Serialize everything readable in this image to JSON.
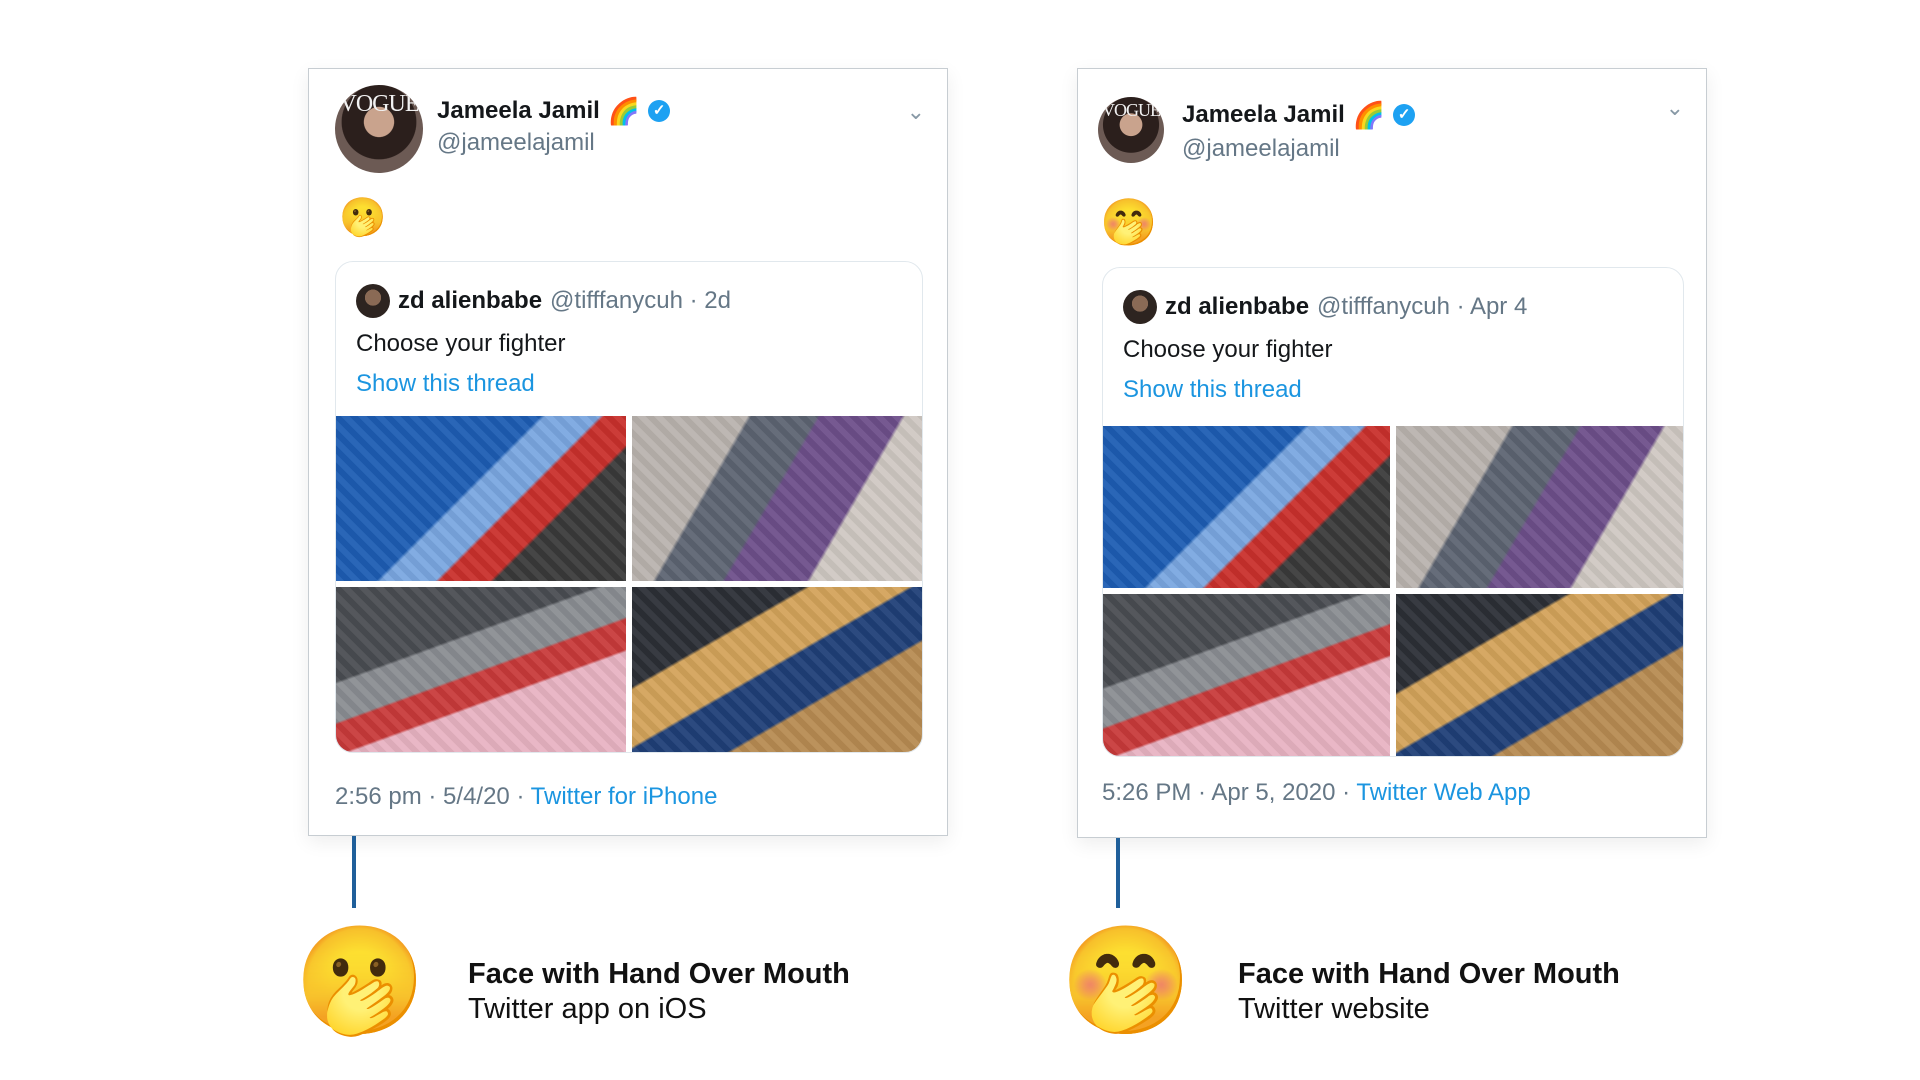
{
  "ios_tweet": {
    "display_name": "Jameela Jamil",
    "name_emoji": "🌈",
    "verified_mark": "✓",
    "handle": "@jameelajamil",
    "avatar_text": "VOGUE",
    "tweet_emoji": "🫢",
    "quote": {
      "name": "zd alienbabe",
      "meta": "@tifffanycuh · 2d",
      "text": "Choose your fighter",
      "link": "Show this thread"
    },
    "footer_time": "2:56 pm · 5/4/20 · ",
    "footer_source": "Twitter for iPhone"
  },
  "web_tweet": {
    "display_name": "Jameela Jamil",
    "name_emoji": "🌈",
    "verified_mark": "✓",
    "handle": "@jameelajamil",
    "avatar_text": "VOGUE",
    "tweet_emoji": "🤭",
    "quote": {
      "name": "zd alienbabe",
      "meta": "@tifffanycuh · Apr 4",
      "text": "Choose your fighter",
      "link": "Show this thread"
    },
    "footer_time": "5:26 PM · Apr 5, 2020 · ",
    "footer_source": "Twitter Web App"
  },
  "captions": {
    "ios": {
      "emoji": "🫢",
      "title": "Face with Hand Over Mouth",
      "subtitle": "Twitter app on iOS"
    },
    "web": {
      "emoji": "🤭",
      "title": "Face with Hand Over Mouth",
      "subtitle": "Twitter website"
    }
  },
  "icons": {
    "caret": "chevron-down-icon",
    "caret_glyph": "⌄"
  },
  "colors": {
    "link": "#1b95e0",
    "verified": "#1da1f2",
    "connector": "#1f5f9a",
    "muted": "#657786"
  }
}
